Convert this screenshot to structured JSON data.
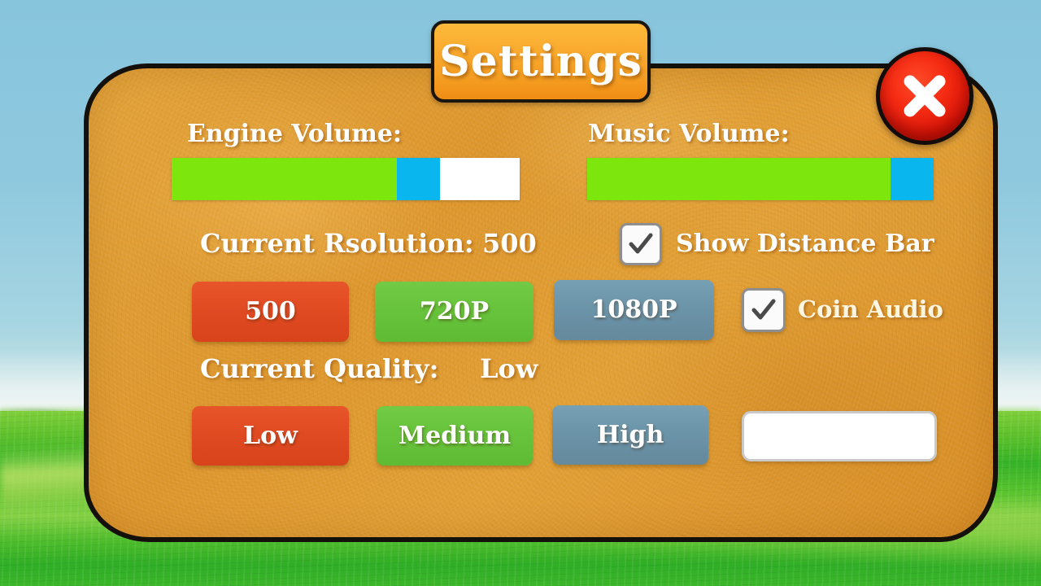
{
  "window": {
    "title": "Settings"
  },
  "header": {
    "title": "Settings",
    "close_icon": "close-x-icon",
    "close_label": "Close"
  },
  "audio": {
    "engine_volume": {
      "label": "Engine Volume:",
      "value_percent": 65,
      "knob_percent": 12,
      "fill_color": "#7ce60d",
      "knob_color": "#09b6ee",
      "track_color": "#ffffff"
    },
    "music_volume": {
      "label": "Music Volume:",
      "value_percent": 87,
      "knob_percent": 13,
      "fill_color": "#7ce60d",
      "knob_color": "#09b6ee",
      "track_color": "#ffffff"
    }
  },
  "resolution": {
    "current_label": "Current Rsolution:",
    "current_value": "500",
    "options": [
      {
        "label": "500",
        "state": "selected",
        "color": "#e04a22"
      },
      {
        "label": "720P",
        "state": "available",
        "color": "#67c33b"
      },
      {
        "label": "1080P",
        "state": "unavailable",
        "color": "#6b93a8"
      }
    ]
  },
  "quality": {
    "current_label": "Current Quality:",
    "current_value": "Low",
    "options": [
      {
        "label": "Low",
        "state": "selected",
        "color": "#e04a22"
      },
      {
        "label": "Medium",
        "state": "available",
        "color": "#67c33b"
      },
      {
        "label": "High",
        "state": "unavailable",
        "color": "#6b93a8"
      }
    ]
  },
  "toggles": [
    {
      "label": "Show Distance Bar",
      "checked": true,
      "icon": "checkmark-icon"
    },
    {
      "label": "Coin Audio",
      "checked": true,
      "icon": "checkmark-icon"
    }
  ],
  "name_field": {
    "value": "",
    "placeholder": ""
  },
  "theme": {
    "panel_orange": "#dd962c",
    "title_orange": "#f9a92e",
    "close_red": "#f42a12",
    "sky_blue": "#8ec8de",
    "grass_green": "#36b327",
    "text_white": "#ffffff",
    "text_cream": "#fff6e2"
  }
}
